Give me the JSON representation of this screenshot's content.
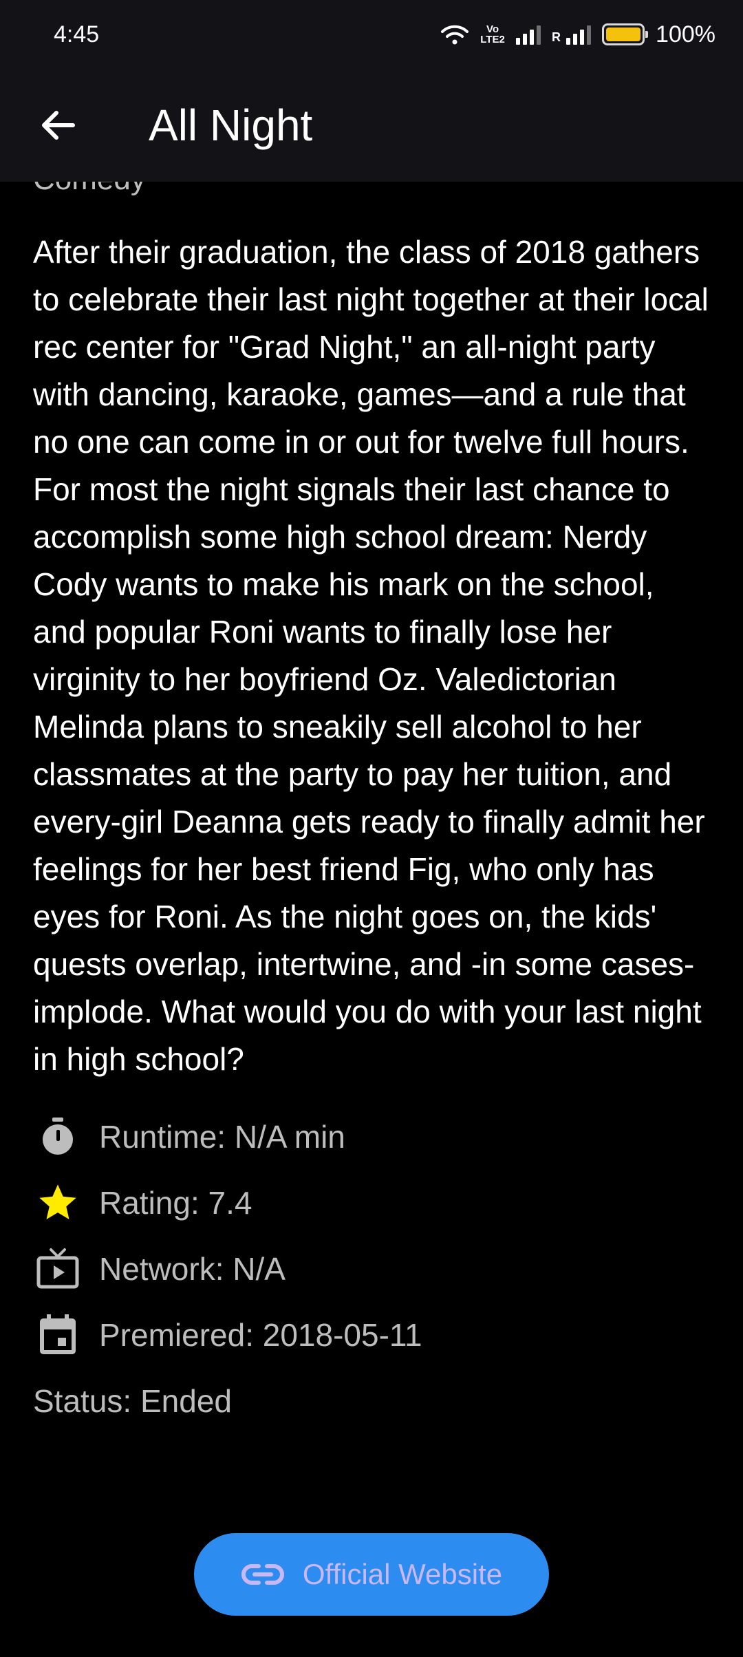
{
  "status_bar": {
    "time": "4:45",
    "volte_label": "Vo LTE2",
    "roaming_letter": "R",
    "battery_percent": "100%"
  },
  "app_bar": {
    "title": "All Night",
    "back_icon": "arrow-left-icon"
  },
  "show": {
    "genre": "Comedy",
    "summary": "After their graduation, the class of 2018 gathers to celebrate their last night together at their local rec center for \"Grad Night,\" an all-night party with dancing, karaoke, games—and a rule that no one can come in or out for twelve full hours. For most the night signals their last chance to accomplish some high school dream: Nerdy Cody wants to make his mark on the school, and popular Roni wants to finally lose her virginity to her boyfriend Oz. Valedictorian Melinda plans to sneakily sell alcohol to her classmates at the party to pay her tuition, and every-girl Deanna gets ready to finally admit her feelings for her best friend Fig, who only has eyes for Roni. As the night goes on, the kids' quests overlap, intertwine, and -in some cases- implode. What would you do with your last night in high school?",
    "runtime": "Runtime: N/A min",
    "rating": "Rating: 7.4",
    "network": "Network: N/A",
    "premiered": "Premiered: 2018-05-11",
    "status": "Status: Ended"
  },
  "icons": {
    "runtime": "timer-icon",
    "rating": "star-icon",
    "network": "tv-icon",
    "premiered": "calendar-icon",
    "website": "link-icon"
  },
  "website_button": {
    "label": "Official Website"
  },
  "colors": {
    "background": "#000000",
    "app_bar": "#131317",
    "button": "#2c8cf0",
    "button_text": "#c9b8f5",
    "star": "#ffeb00",
    "secondary_text": "#bdbdbd"
  }
}
